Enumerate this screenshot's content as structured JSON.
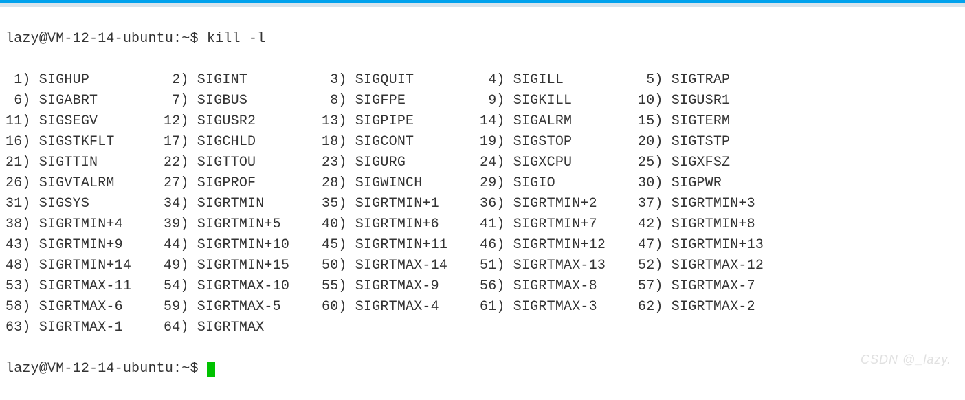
{
  "prompt_user": "lazy",
  "prompt_host": "VM-12-14-ubuntu",
  "prompt_path": "~",
  "prompt_symbol": "$",
  "command": "kill -l",
  "watermark": "CSDN @_lazy.",
  "signals": [
    {
      "n": 1,
      "name": "SIGHUP"
    },
    {
      "n": 2,
      "name": "SIGINT"
    },
    {
      "n": 3,
      "name": "SIGQUIT"
    },
    {
      "n": 4,
      "name": "SIGILL"
    },
    {
      "n": 5,
      "name": "SIGTRAP"
    },
    {
      "n": 6,
      "name": "SIGABRT"
    },
    {
      "n": 7,
      "name": "SIGBUS"
    },
    {
      "n": 8,
      "name": "SIGFPE"
    },
    {
      "n": 9,
      "name": "SIGKILL"
    },
    {
      "n": 10,
      "name": "SIGUSR1"
    },
    {
      "n": 11,
      "name": "SIGSEGV"
    },
    {
      "n": 12,
      "name": "SIGUSR2"
    },
    {
      "n": 13,
      "name": "SIGPIPE"
    },
    {
      "n": 14,
      "name": "SIGALRM"
    },
    {
      "n": 15,
      "name": "SIGTERM"
    },
    {
      "n": 16,
      "name": "SIGSTKFLT"
    },
    {
      "n": 17,
      "name": "SIGCHLD"
    },
    {
      "n": 18,
      "name": "SIGCONT"
    },
    {
      "n": 19,
      "name": "SIGSTOP"
    },
    {
      "n": 20,
      "name": "SIGTSTP"
    },
    {
      "n": 21,
      "name": "SIGTTIN"
    },
    {
      "n": 22,
      "name": "SIGTTOU"
    },
    {
      "n": 23,
      "name": "SIGURG"
    },
    {
      "n": 24,
      "name": "SIGXCPU"
    },
    {
      "n": 25,
      "name": "SIGXFSZ"
    },
    {
      "n": 26,
      "name": "SIGVTALRM"
    },
    {
      "n": 27,
      "name": "SIGPROF"
    },
    {
      "n": 28,
      "name": "SIGWINCH"
    },
    {
      "n": 29,
      "name": "SIGIO"
    },
    {
      "n": 30,
      "name": "SIGPWR"
    },
    {
      "n": 31,
      "name": "SIGSYS"
    },
    {
      "n": 34,
      "name": "SIGRTMIN"
    },
    {
      "n": 35,
      "name": "SIGRTMIN+1"
    },
    {
      "n": 36,
      "name": "SIGRTMIN+2"
    },
    {
      "n": 37,
      "name": "SIGRTMIN+3"
    },
    {
      "n": 38,
      "name": "SIGRTMIN+4"
    },
    {
      "n": 39,
      "name": "SIGRTMIN+5"
    },
    {
      "n": 40,
      "name": "SIGRTMIN+6"
    },
    {
      "n": 41,
      "name": "SIGRTMIN+7"
    },
    {
      "n": 42,
      "name": "SIGRTMIN+8"
    },
    {
      "n": 43,
      "name": "SIGRTMIN+9"
    },
    {
      "n": 44,
      "name": "SIGRTMIN+10"
    },
    {
      "n": 45,
      "name": "SIGRTMIN+11"
    },
    {
      "n": 46,
      "name": "SIGRTMIN+12"
    },
    {
      "n": 47,
      "name": "SIGRTMIN+13"
    },
    {
      "n": 48,
      "name": "SIGRTMIN+14"
    },
    {
      "n": 49,
      "name": "SIGRTMIN+15"
    },
    {
      "n": 50,
      "name": "SIGRTMAX-14"
    },
    {
      "n": 51,
      "name": "SIGRTMAX-13"
    },
    {
      "n": 52,
      "name": "SIGRTMAX-12"
    },
    {
      "n": 53,
      "name": "SIGRTMAX-11"
    },
    {
      "n": 54,
      "name": "SIGRTMAX-10"
    },
    {
      "n": 55,
      "name": "SIGRTMAX-9"
    },
    {
      "n": 56,
      "name": "SIGRTMAX-8"
    },
    {
      "n": 57,
      "name": "SIGRTMAX-7"
    },
    {
      "n": 58,
      "name": "SIGRTMAX-6"
    },
    {
      "n": 59,
      "name": "SIGRTMAX-5"
    },
    {
      "n": 60,
      "name": "SIGRTMAX-4"
    },
    {
      "n": 61,
      "name": "SIGRTMAX-3"
    },
    {
      "n": 62,
      "name": "SIGRTMAX-2"
    },
    {
      "n": 63,
      "name": "SIGRTMAX-1"
    },
    {
      "n": 64,
      "name": "SIGRTMAX"
    }
  ]
}
